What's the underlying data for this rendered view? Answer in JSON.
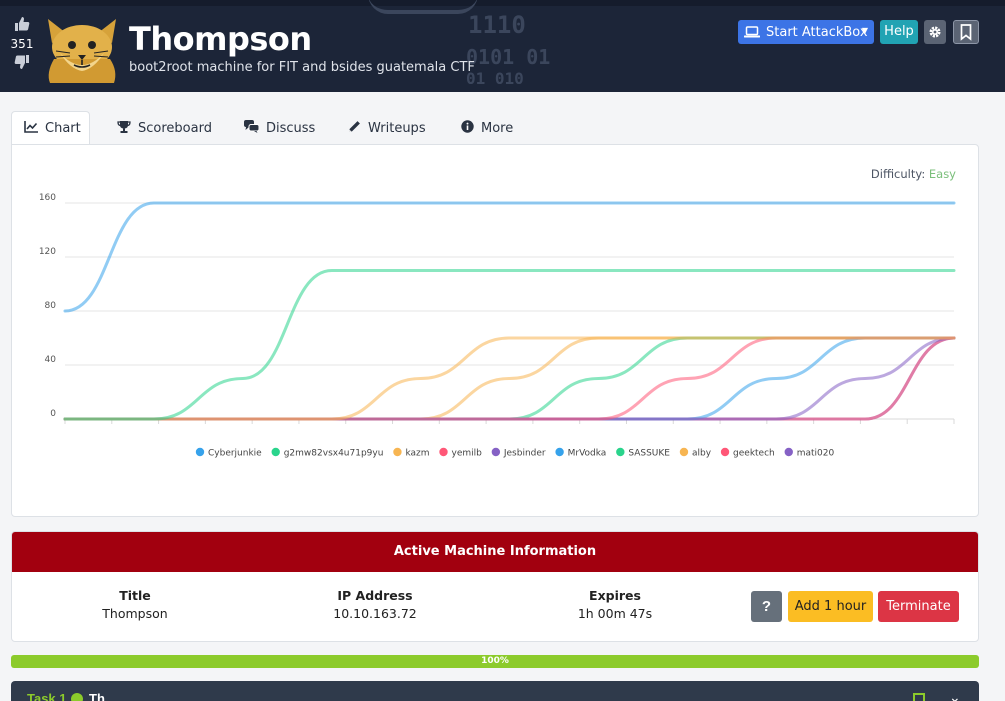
{
  "header": {
    "vote_count": "351",
    "title": "Thompson",
    "subtitle": "boot2root machine for FIT and bsides guatemala CTF",
    "start_attackbox_label": "Start AttackBox",
    "help_label": "Help",
    "binary_lines": [
      "1110",
      "0101  01",
      "01    010"
    ]
  },
  "tabs": [
    {
      "label": "Chart",
      "icon": "line-chart-icon"
    },
    {
      "label": "Scoreboard",
      "icon": "trophy-icon"
    },
    {
      "label": "Discuss",
      "icon": "comments-icon"
    },
    {
      "label": "Writeups",
      "icon": "pencil-icon"
    },
    {
      "label": "More",
      "icon": "info-circle-icon"
    }
  ],
  "difficulty": {
    "label": "Difficulty:",
    "value": "Easy",
    "value_color": "#7bbf7b"
  },
  "chart_data": {
    "type": "line",
    "x": [
      0,
      1,
      2,
      3,
      4,
      5,
      6,
      7,
      8,
      9,
      10
    ],
    "ylim": [
      0,
      160
    ],
    "yticks": [
      0,
      40,
      80,
      120,
      160
    ],
    "grid": true,
    "legend_position": "bottom",
    "series": [
      {
        "name": "Cyberjunkie",
        "color": "#36a2eb",
        "values": [
          80,
          160,
          160,
          160,
          160,
          160,
          160,
          160,
          160,
          160,
          160
        ]
      },
      {
        "name": "g2mw82vsx4u71p9yu",
        "color": "#2ad48c",
        "values": [
          0,
          0,
          30,
          110,
          110,
          110,
          110,
          110,
          110,
          110,
          110
        ]
      },
      {
        "name": "kazm",
        "color": "#f7b552",
        "values": [
          0,
          0,
          0,
          0,
          30,
          60,
          60,
          60,
          60,
          60,
          60
        ]
      },
      {
        "name": "yemilb",
        "color": "#ff5777",
        "values": [
          0,
          0,
          0,
          0,
          0,
          0,
          0,
          30,
          60,
          60,
          60
        ]
      },
      {
        "name": "Jesbinder",
        "color": "#8561c5",
        "values": [
          0,
          0,
          0,
          0,
          0,
          0,
          0,
          0,
          0,
          30,
          60
        ]
      },
      {
        "name": "MrVodka",
        "color": "#36a2eb",
        "values": [
          0,
          0,
          0,
          0,
          0,
          0,
          0,
          0,
          30,
          60,
          60
        ]
      },
      {
        "name": "SASSUKE",
        "color": "#2ad48c",
        "values": [
          0,
          0,
          0,
          0,
          0,
          0,
          30,
          60,
          60,
          60,
          60
        ]
      },
      {
        "name": "alby",
        "color": "#f7b552",
        "values": [
          0,
          0,
          0,
          0,
          0,
          30,
          60,
          60,
          60,
          60,
          60
        ]
      },
      {
        "name": "geektech",
        "color": "#ff5777",
        "values": [
          0,
          0,
          0,
          0,
          0,
          0,
          0,
          0,
          0,
          0,
          60
        ]
      },
      {
        "name": "mati020",
        "color": "#8561c5",
        "values": [
          0,
          0,
          0,
          0,
          0,
          0,
          0,
          0,
          0,
          0,
          60
        ]
      }
    ]
  },
  "machine": {
    "heading": "Active Machine Information",
    "title_label": "Title",
    "title_value": "Thompson",
    "ip_label": "IP Address",
    "ip_value": "10.10.163.72",
    "expires_label": "Expires",
    "expires_value": "1h 00m 47s",
    "help_label": "?",
    "add_hour_label": "Add 1 hour",
    "terminate_label": "Terminate"
  },
  "progress": {
    "value": 1.0,
    "label": "100%"
  },
  "task": {
    "label": "Task 1",
    "title": "Th"
  }
}
